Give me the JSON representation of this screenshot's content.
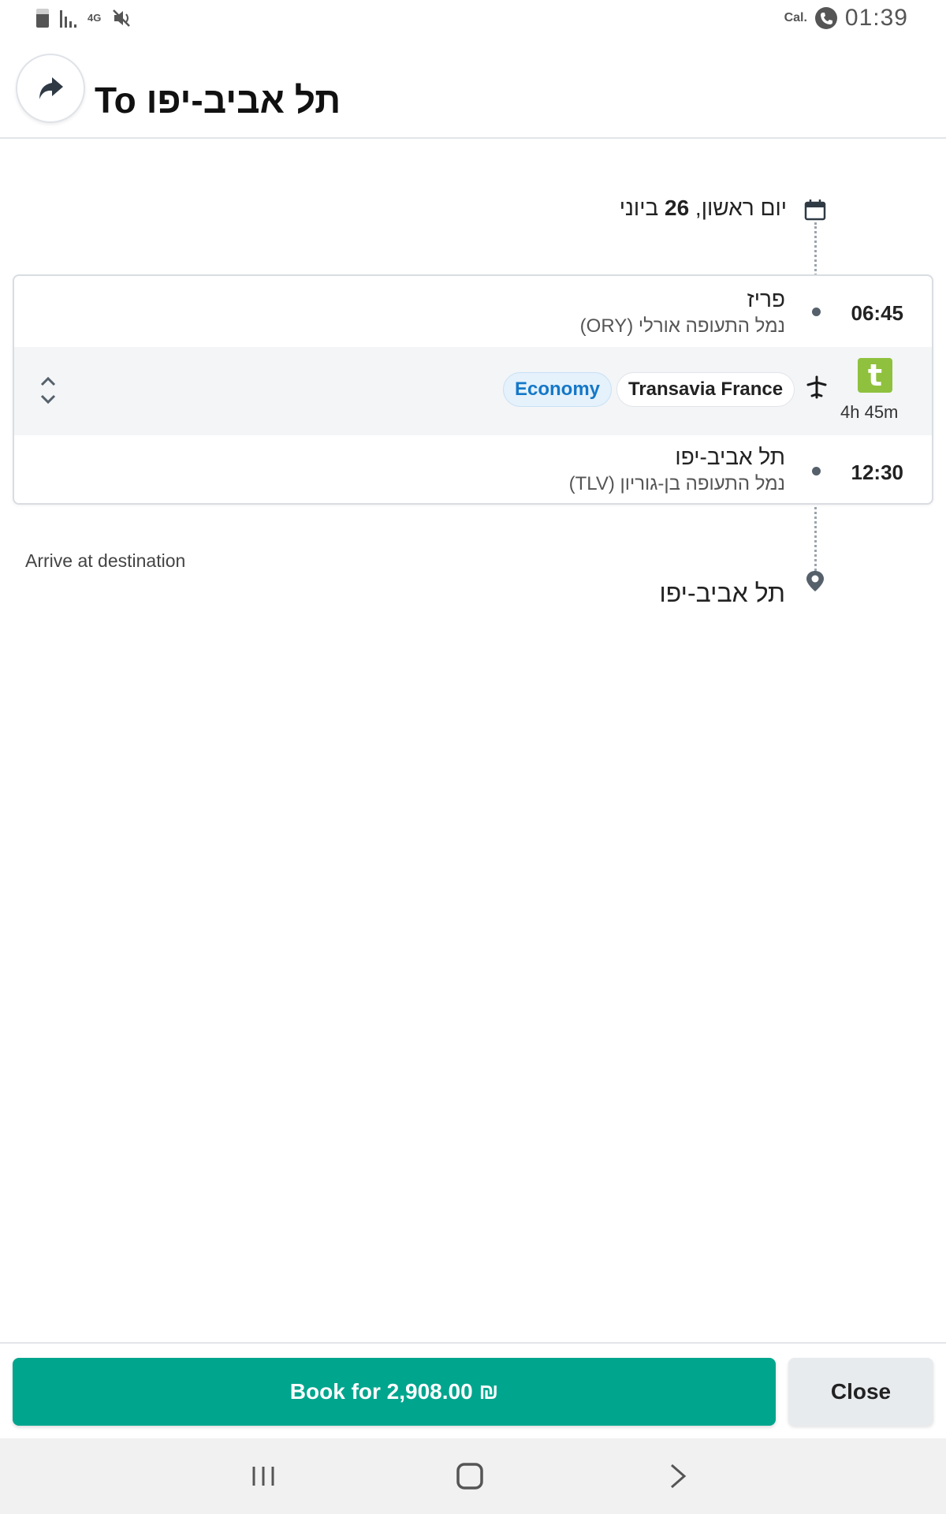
{
  "status_bar": {
    "network": "4G",
    "carrier_label": "Cal.",
    "time": "01:39"
  },
  "header": {
    "title": "To תל אביב-יפו"
  },
  "trip": {
    "date_prefix": "יום ראשון, ",
    "date_day": "26",
    "date_suffix": " ביוני",
    "departure": {
      "city": "פריז",
      "airport": "נמל התעופה אורלי (ORY)",
      "time": "06:45"
    },
    "segment": {
      "cabin_class": "Economy",
      "airline": "Transavia France",
      "airline_logo_letter": "t",
      "duration": "4h 45m"
    },
    "arrival": {
      "city": "תל אביב-יפו",
      "airport": "נמל התעופה בן-גוריון (TLV)",
      "time": "12:30"
    },
    "arrive_label": "Arrive at destination",
    "destination_city": "תל אביב-יפו"
  },
  "footer": {
    "book_label": "Book for 2,908.00 ₪",
    "close_label": "Close"
  },
  "colors": {
    "accent_green": "#00a58e",
    "economy_blue": "#1478c8",
    "airline_logo_green": "#8fc13e"
  },
  "icons": [
    "battery-icon",
    "signal-icon",
    "mute-icon",
    "phone-icon",
    "share-icon",
    "calendar-icon",
    "plane-icon",
    "expand-icon",
    "location-pin-icon",
    "recent-apps-icon",
    "home-icon",
    "back-icon"
  ]
}
